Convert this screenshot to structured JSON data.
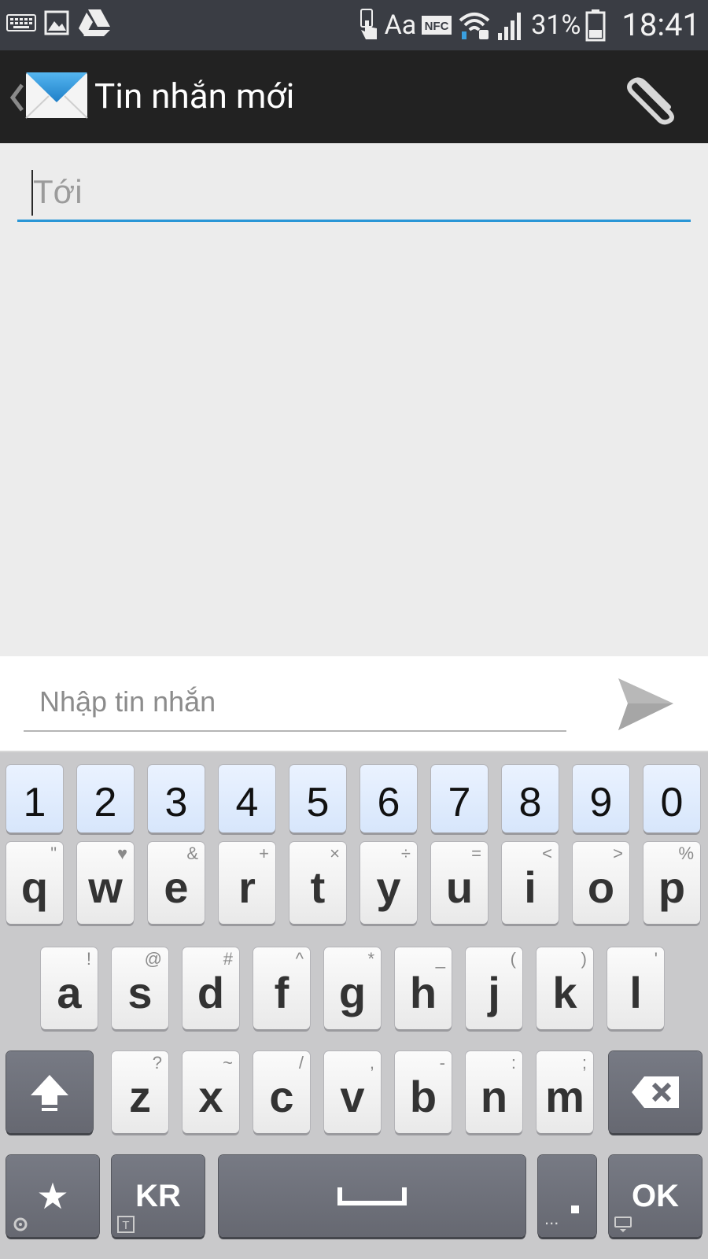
{
  "status_bar": {
    "left_icons": [
      "keyboard-icon",
      "gallery-icon",
      "drive-icon"
    ],
    "right_icons": [
      "touch-icon",
      "nfc-icon",
      "wifi-icon",
      "signal-icon",
      "battery-icon"
    ],
    "font_label": "Aa",
    "nfc_label": "NFC",
    "battery": "31%",
    "time": "18:41"
  },
  "action_bar": {
    "title": "Tin nhắn mới",
    "icons": [
      "back-chevron-icon",
      "mail-icon",
      "paperclip-icon"
    ]
  },
  "compose": {
    "to_placeholder": "Tới",
    "message_placeholder": "Nhập tin nhắn",
    "send_icon": "send-icon",
    "accent_color": "#2a96d6"
  },
  "keyboard": {
    "number_row": [
      "1",
      "2",
      "3",
      "4",
      "5",
      "6",
      "7",
      "8",
      "9",
      "0"
    ],
    "row1": [
      {
        "key": "q",
        "sec": "\""
      },
      {
        "key": "w",
        "sec": "♥"
      },
      {
        "key": "e",
        "sec": "&"
      },
      {
        "key": "r",
        "sec": "+"
      },
      {
        "key": "t",
        "sec": "×"
      },
      {
        "key": "y",
        "sec": "÷"
      },
      {
        "key": "u",
        "sec": "="
      },
      {
        "key": "i",
        "sec": "<"
      },
      {
        "key": "o",
        "sec": ">"
      },
      {
        "key": "p",
        "sec": "%"
      }
    ],
    "row2": [
      {
        "key": "a",
        "sec": "!"
      },
      {
        "key": "s",
        "sec": "@"
      },
      {
        "key": "d",
        "sec": "#"
      },
      {
        "key": "f",
        "sec": "^"
      },
      {
        "key": "g",
        "sec": "*"
      },
      {
        "key": "h",
        "sec": "_"
      },
      {
        "key": "j",
        "sec": "("
      },
      {
        "key": "k",
        "sec": ")"
      },
      {
        "key": "l",
        "sec": "'"
      }
    ],
    "row3": [
      {
        "key": "z",
        "sec": "?"
      },
      {
        "key": "x",
        "sec": "~"
      },
      {
        "key": "c",
        "sec": "/"
      },
      {
        "key": "v",
        "sec": ","
      },
      {
        "key": "b",
        "sec": "-"
      },
      {
        "key": "n",
        "sec": ":"
      },
      {
        "key": "m",
        "sec": ";"
      }
    ],
    "bottom": {
      "symbols_label": "★",
      "lang_label": "KR",
      "period_label": "...",
      "ok_label": "OK"
    }
  }
}
